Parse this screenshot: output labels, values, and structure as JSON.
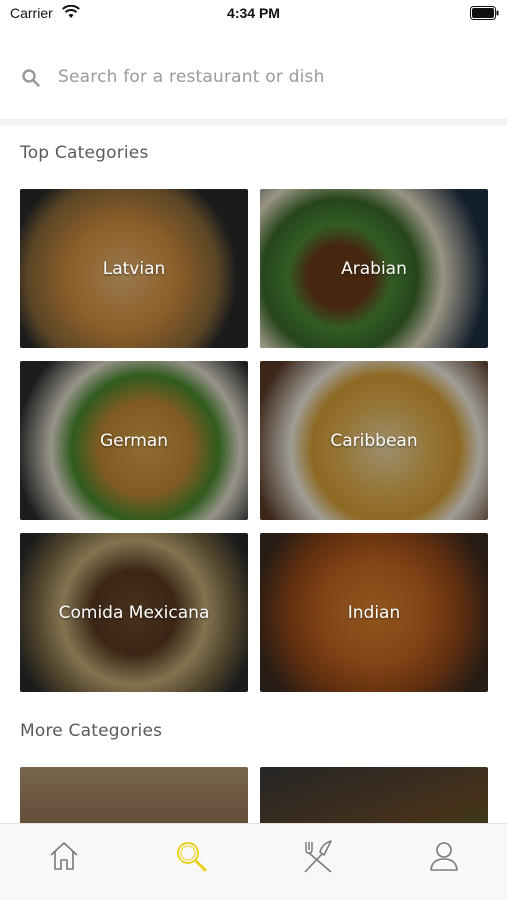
{
  "status_bar": {
    "carrier": "Carrier",
    "time": "4:34 PM"
  },
  "search": {
    "placeholder": "Search for a restaurant or dish",
    "value": ""
  },
  "sections": {
    "top_title": "Top Categories",
    "more_title": "More Categories"
  },
  "top_categories": [
    {
      "label": "Latvian"
    },
    {
      "label": "Arabian"
    },
    {
      "label": "German"
    },
    {
      "label": "Caribbean"
    },
    {
      "label": "Comida Mexicana"
    },
    {
      "label": "Indian"
    }
  ],
  "tabs": [
    {
      "icon": "home-icon",
      "active": false
    },
    {
      "icon": "search-icon",
      "active": true
    },
    {
      "icon": "fork-knife-icon",
      "active": false
    },
    {
      "icon": "profile-icon",
      "active": false
    }
  ],
  "colors": {
    "active_tab": "#e8d21d",
    "inactive_tab": "#7a7a7a",
    "tab_bar_bg": "#f8f8f8"
  }
}
